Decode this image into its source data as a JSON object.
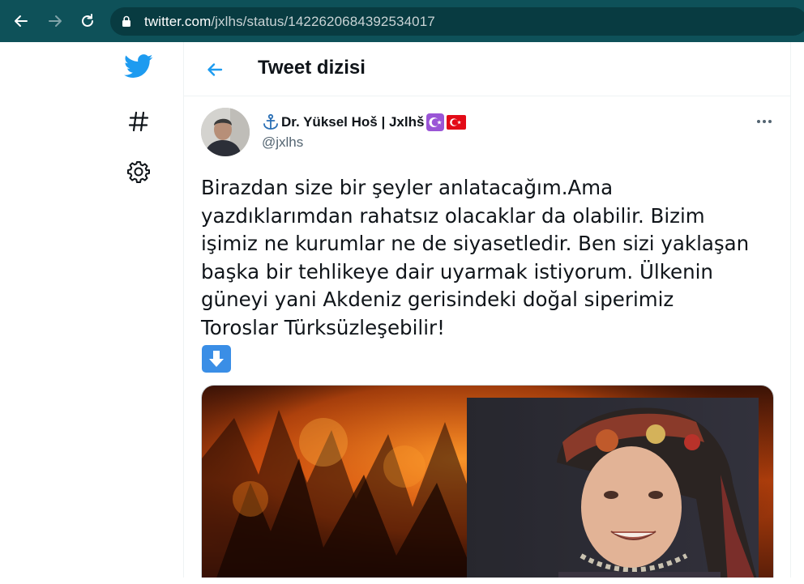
{
  "browser": {
    "url_host": "twitter.com",
    "url_path": "/jxlhs/status/1422620684392534017"
  },
  "nav": {
    "items": [
      {
        "icon": "twitter-bird-icon"
      },
      {
        "icon": "hashtag-icon"
      },
      {
        "icon": "settings-icon"
      }
    ]
  },
  "header": {
    "title": "Tweet dizisi"
  },
  "tweet": {
    "author_name": "Dr. Yüksel Hoš | Jxlhš",
    "author_handle": "@jxlhs",
    "text": "Birazdan size bir şeyler anlatacağım.Ama\nyazdıklarımdan rahatsız olacaklar da olabilir. Bizim\nişimiz ne kurumlar ne de siyasetledir. Ben sizi yaklaşan\nbaşka bir tehlikeye dair uyarmak istiyorum. Ülkenin\ngüneyi yani Akdeniz gerisindeki doğal siperimiz\nToroslar Türksüzleşebilir!"
  },
  "colors": {
    "chrome": "#0e5159",
    "twitter_blue": "#1d9bf0",
    "text": "#0f1419",
    "muted": "#536471"
  }
}
